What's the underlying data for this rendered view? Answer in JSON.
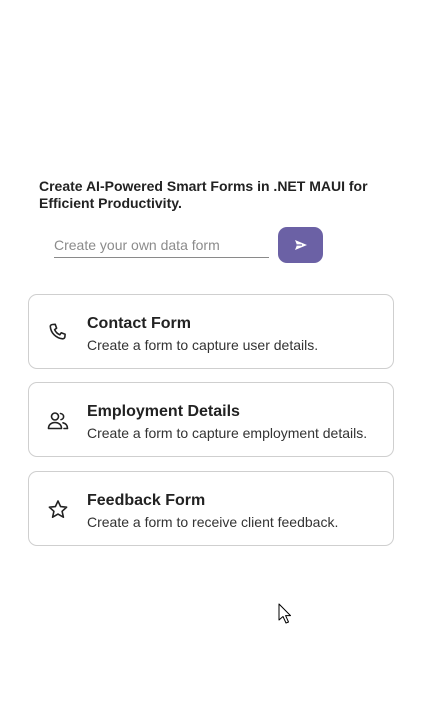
{
  "header": {
    "title": "Create AI-Powered Smart Forms in .NET MAUI for Efficient Productivity."
  },
  "prompt": {
    "placeholder": "Create your own data form",
    "value": "",
    "send_icon": "send-icon"
  },
  "cards": [
    {
      "icon": "phone-icon",
      "title": "Contact Form",
      "description": "Create a form to capture user details."
    },
    {
      "icon": "people-icon",
      "title": "Employment Details",
      "description": "Create a form to capture employment details."
    },
    {
      "icon": "star-icon",
      "title": "Feedback Form",
      "description": "Create a form to receive client feedback."
    }
  ],
  "colors": {
    "accent": "#6b61a5",
    "card_border": "#cfcfcf",
    "text": "#222222"
  }
}
